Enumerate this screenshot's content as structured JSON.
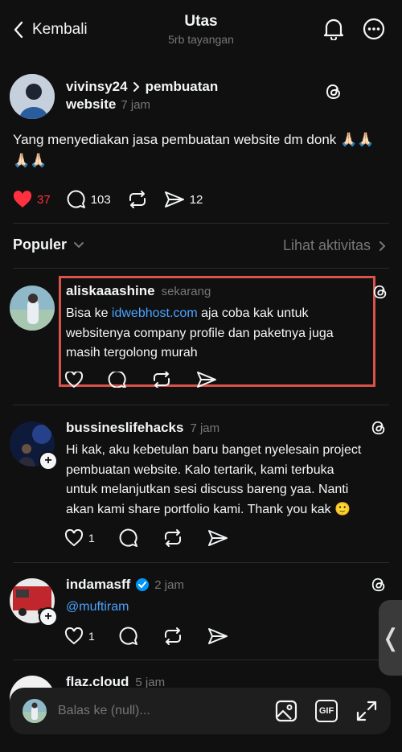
{
  "header": {
    "back_label": "Kembali",
    "title": "Utas",
    "subtitle": "5rb tayangan"
  },
  "main_post": {
    "username": "vivinsy24",
    "thread_topic": "pembuatan",
    "thread_topic_line2": "website",
    "time": "7 jam",
    "text_line1": "Yang menyediakan jasa pembuatan website dm donk 🙏🏻🙏🏻",
    "text_line2": "🙏🏻🙏🏻",
    "likes": "37",
    "replies": "103",
    "shares": "12"
  },
  "sort": {
    "label": "Populer",
    "activity_link": "Lihat aktivitas"
  },
  "replies": [
    {
      "username": "aliskaaashine",
      "time": "sekarang",
      "link_text": "idwebhost.com",
      "line1_prefix": "Bisa ke ",
      "line1_suffix": " aja coba kak untuk",
      "line2": "websitenya company profile dan paketnya juga",
      "line3": "masih tergolong murah",
      "highlight_color": "#d9534a"
    },
    {
      "username": "bussineslifehacks",
      "time": "7 jam",
      "line1": "Hi kak, aku kebetulan baru banget nyelesain project",
      "line2": "pembuatan website. Kalo tertarik, kami terbuka",
      "line3": "untuk melanjutkan sesi discuss bareng yaa. Nanti",
      "line4": "akan kami share portfolio kami. Thank you kak 🙂",
      "likes": "1"
    },
    {
      "username": "indamasff",
      "time": "2 jam",
      "mention": "@muftiram",
      "likes": "1"
    },
    {
      "username": "flaz.cloud",
      "time": "5 jam"
    }
  ],
  "composer": {
    "placeholder": "Balas ke (null)...",
    "gif_label": "GIF"
  },
  "side_handle": {
    "glyph": "❬"
  },
  "colors": {
    "background": "#101010",
    "like_red": "#ff3040",
    "link_blue": "#4aa3ff",
    "verified_blue": "#0095f6"
  }
}
